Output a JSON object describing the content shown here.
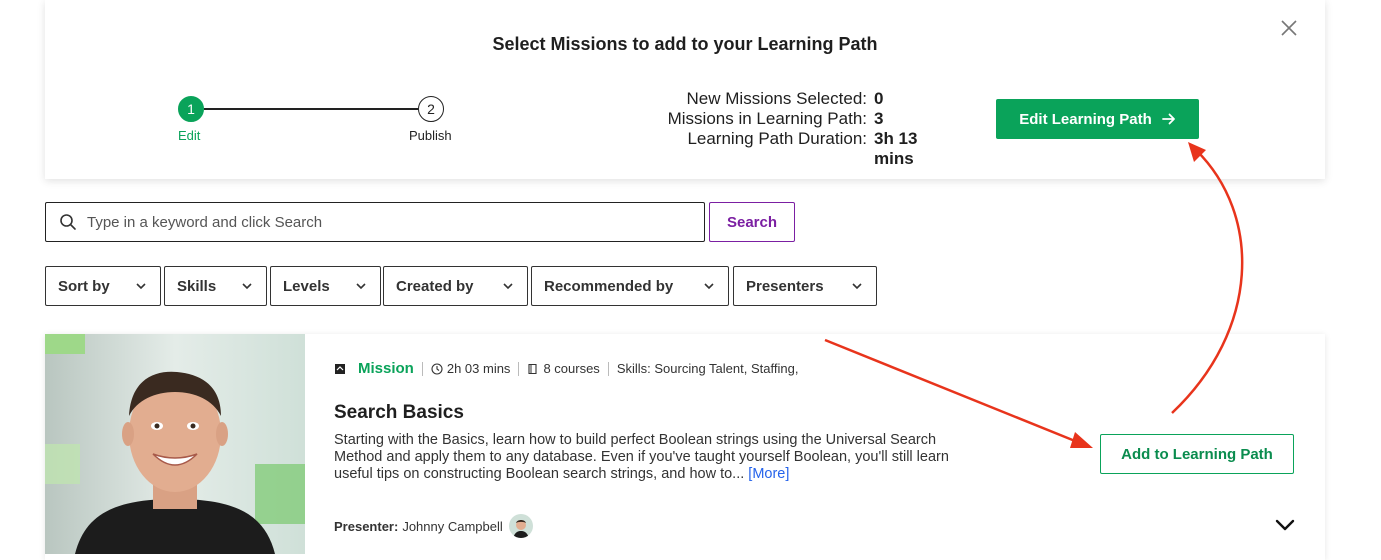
{
  "panel": {
    "title": "Select Missions to add to your Learning Path",
    "steps": [
      {
        "number": "1",
        "label": "Edit"
      },
      {
        "number": "2",
        "label": "Publish"
      }
    ],
    "stats": [
      {
        "label": "New Missions Selected:",
        "value": "0"
      },
      {
        "label": "Missions in Learning Path:",
        "value": "3"
      },
      {
        "label": "Learning Path Duration:",
        "value": "3h 13 mins"
      }
    ],
    "edit_button_label": "Edit Learning Path"
  },
  "search": {
    "placeholder": "Type in a keyword and click Search",
    "value": "",
    "button_label": "Search"
  },
  "filters": [
    "Sort by",
    "Skills",
    "Levels",
    "Created by",
    "Recommended by",
    "Presenters"
  ],
  "mission": {
    "type": "Mission",
    "duration": "2h 03 mins",
    "courses": "8 courses",
    "skills": "Skills: Sourcing Talent, Staffing,",
    "title": "Search Basics",
    "description": "Starting with the Basics, learn how to build perfect Boolean strings using the Universal Search Method and apply them to any database. Even if you've taught yourself Boolean, you'll still learn useful tips on constructing Boolean search strings, and how to...",
    "more_label": "[More]",
    "presenter_label": "Presenter:",
    "presenter_name": "Johnny Campbell",
    "add_button_label": "Add to Learning Path"
  },
  "colors": {
    "accent_green": "#0aa35a",
    "search_purple": "#7b1fa2",
    "annotation_red": "#e8341c",
    "link_blue": "#2563eb"
  },
  "icons": [
    "close-icon",
    "search-icon",
    "chevron-down-icon",
    "mission-icon",
    "clock-icon",
    "book-icon",
    "arrow-right-icon"
  ]
}
